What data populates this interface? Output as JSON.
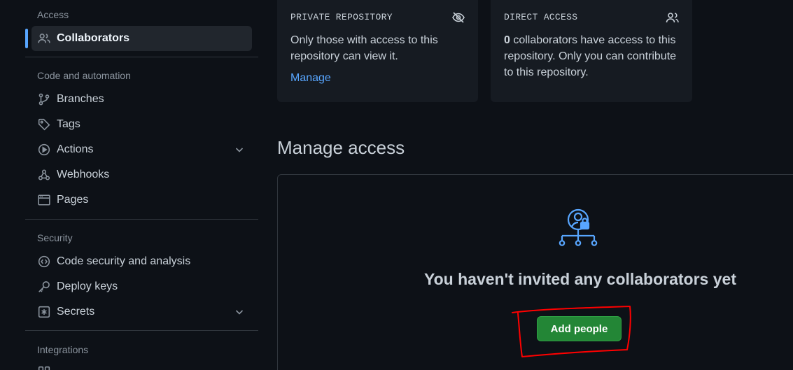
{
  "sidebar": {
    "access_heading": "Access",
    "access_items": [
      {
        "label": "Collaborators",
        "icon": "people-icon",
        "active": true
      }
    ],
    "code_heading": "Code and automation",
    "code_items": [
      {
        "label": "Branches",
        "icon": "git-branch-icon"
      },
      {
        "label": "Tags",
        "icon": "tag-icon"
      },
      {
        "label": "Actions",
        "icon": "play-icon",
        "expandable": true
      },
      {
        "label": "Webhooks",
        "icon": "webhook-icon"
      },
      {
        "label": "Pages",
        "icon": "browser-icon"
      }
    ],
    "security_heading": "Security",
    "security_items": [
      {
        "label": "Code security and analysis",
        "icon": "codescan-icon"
      },
      {
        "label": "Deploy keys",
        "icon": "key-icon"
      },
      {
        "label": "Secrets",
        "icon": "asterisk-icon",
        "expandable": true
      }
    ],
    "integrations_heading": "Integrations"
  },
  "cards": {
    "private": {
      "label": "PRIVATE REPOSITORY",
      "icon": "eye-closed-icon",
      "text": "Only those with access to this repository can view it.",
      "link": "Manage"
    },
    "direct": {
      "label": "DIRECT ACCESS",
      "icon": "people-icon",
      "count": "0",
      "text": " collaborators have access to this repository. Only you can contribute to this repository."
    }
  },
  "manage_access": {
    "title": "Manage access",
    "empty_icon": "people-lock-network-icon",
    "empty_text": "You haven't invited any collaborators yet",
    "add_button": "Add people"
  },
  "colors": {
    "accent": "#58a6ff",
    "button": "#238636",
    "annotation": "#ff0000"
  }
}
